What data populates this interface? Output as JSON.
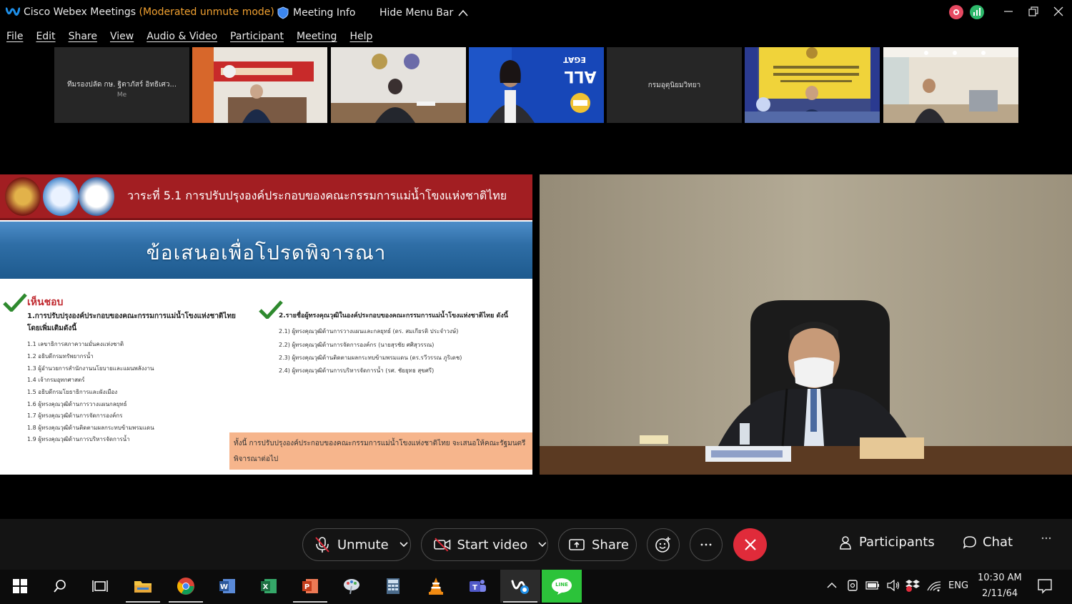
{
  "window": {
    "app_name": "Cisco Webex Meetings",
    "mode_label": "(Moderated unmute mode)",
    "meeting_info_label": "Meeting Info",
    "hide_menu_label": "Hide Menu Bar",
    "icons": {
      "logo": "webex-logo-icon",
      "meeting_info": "shield-icon",
      "hide_menu": "chevron-up-icon",
      "recording": "recording-icon",
      "stats": "network-stats-icon",
      "minimize": "minimize-icon",
      "restore": "restore-icon",
      "close": "close-icon"
    }
  },
  "menu": [
    "File",
    "Edit",
    "Share",
    "View",
    "Audio & Video",
    "Participant",
    "Meeting",
    "Help"
  ],
  "thumbnails": [
    {
      "name": "ทีมรองปลัด กษ. ฐิตาภัสร์ อิทธิเศว...",
      "sub": "Me",
      "type": "name-card"
    },
    {
      "type": "video",
      "scene": "office-red-banner"
    },
    {
      "type": "video",
      "scene": "office-emblems"
    },
    {
      "type": "video",
      "scene": "egat-blue"
    },
    {
      "name": "กรมอุตุนิยมวิทยา",
      "type": "name-card"
    },
    {
      "type": "video",
      "scene": "yellow-sign"
    },
    {
      "type": "video",
      "scene": "office-room"
    }
  ],
  "egat_label": "EGAT ALL",
  "slide": {
    "header": "วาระที่ 5.1 การปรับปรุงองค์ประกอบของคณะกรรมการแม่น้ำโขงแห่งชาติไทย",
    "banner": "ข้อเสนอเพื่อโปรดพิจารณา",
    "approve_label": "เห็นชอบ",
    "left_heading": "1.การปรับปรุงองค์ประกอบของคณะกรรมการแม่น้ำโขงแห่งชาติไทย โดยเพิ่มเติมดังนี้",
    "left_items": [
      "1.1 เลขาธิการสภาความมั่นคงแห่งชาติ",
      "1.2 อธิบดีกรมทรัพยากรน้ำ",
      "1.3 ผู้อำนวยการสำนักงานนโยบายและแผนพลังงาน",
      "1.4 เจ้ากรมอุทกศาสตร์",
      "1.5 อธิบดีกรมโยธาธิการและผังเมือง",
      "1.6 ผู้ทรงคุณวุฒิด้านการวางแผนกลยุทธ์",
      "1.7 ผู้ทรงคุณวุฒิด้านการจัดการองค์กร",
      "1.8 ผู้ทรงคุณวุฒิด้านติดตามผลกระทบข้ามพรมแดน",
      "1.9 ผู้ทรงคุณวุฒิด้านการบริหารจัดการน้ำ"
    ],
    "right_heading": "2.รายชื่อผู้ทรงคุณวุฒิในองค์ประกอบของคณะกรรมการแม่น้ำโขงแห่งชาติไทย ดังนี้",
    "right_items": [
      "2.1) ผู้ทรงคุณวุฒิด้านการวางแผนและกลยุทธ์ (ดร. สมเกียรติ ประจำวงษ์)",
      "2.2) ผู้ทรงคุณวุฒิด้านการจัดการองค์กร (นายสุรชัย ศศิสุวรรณ)",
      "2.3) ผู้ทรงคุณวุฒิด้านติดตามผลกระทบข้ามพรมแดน (ดร.รวีวรรณ ภูริเดช)",
      "2.4) ผู้ทรงคุณวุฒิด้านการบริหารจัดการน้ำ (รศ. ชัยยุทธ สุขศรี)"
    ],
    "note": "ทั้งนี้ การปรับปรุงองค์ประกอบของคณะกรรมการแม่น้ำโขงแห่งชาติไทย จะเสนอให้คณะรัฐมนตรีพิจารณาต่อไป"
  },
  "controls": {
    "unmute": "Unmute",
    "start_video": "Start video",
    "share": "Share",
    "participants": "Participants",
    "chat": "Chat"
  },
  "taskbar": {
    "apps": [
      "start",
      "search",
      "task-view",
      "file-explorer",
      "chrome",
      "word",
      "excel",
      "powerpoint",
      "paint",
      "calculator",
      "vlc",
      "teams",
      "webex",
      "line"
    ],
    "line_label": "LINE",
    "language": "ENG",
    "time": "10:30 AM",
    "date": "2/11/64",
    "colors": {
      "accent_red": "#e02b3a",
      "mode_orange": "#f0a030",
      "slide_red": "#a21e22",
      "note_peach": "#f6b58c"
    }
  }
}
